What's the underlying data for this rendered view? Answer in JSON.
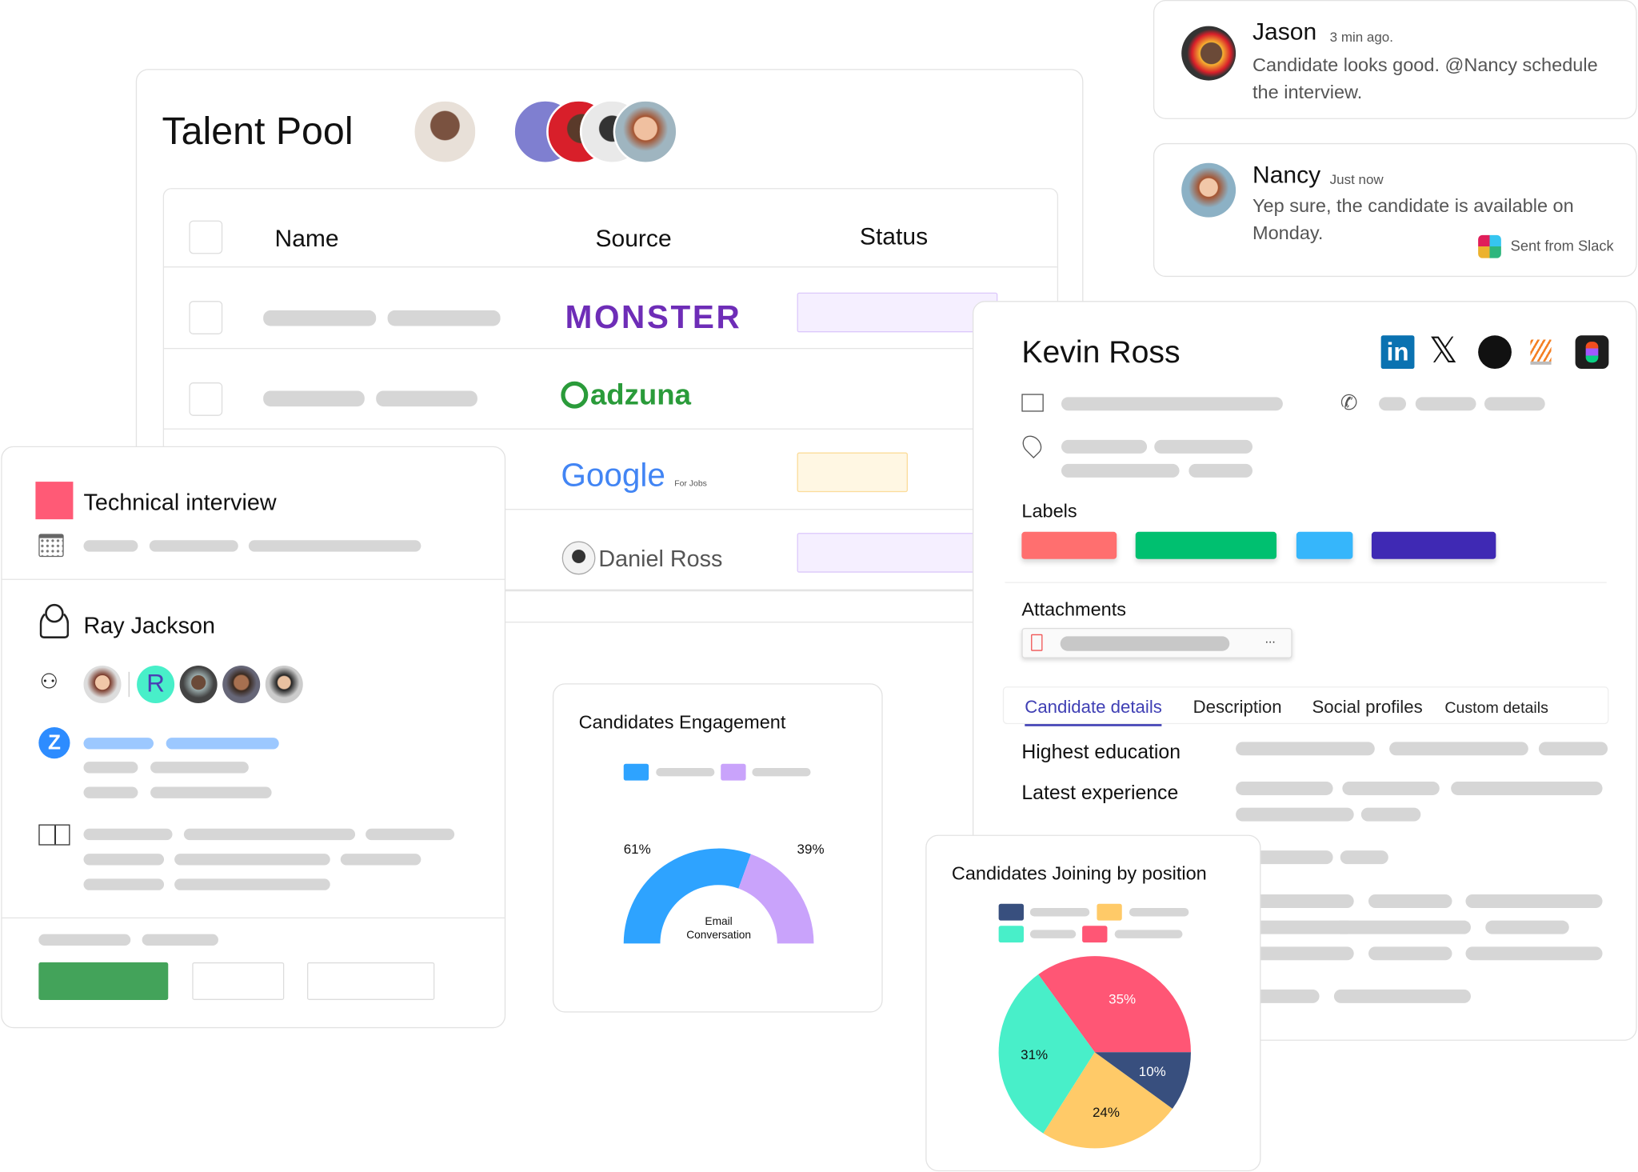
{
  "talent_pool": {
    "title": "Talent Pool",
    "columns": [
      "Name",
      "Source",
      "Status"
    ],
    "sources": [
      "MONSTER",
      "adzuna",
      "Google",
      "For Jobs",
      "Daniel Ross"
    ],
    "status_colors": [
      "#f5efff",
      "#fff7e3",
      "#f5efff"
    ]
  },
  "chat": [
    {
      "name": "Jason",
      "time": "3 min ago.",
      "message": "Candidate looks good. @Nancy schedule the interview."
    },
    {
      "name": "Nancy",
      "time": "Just now",
      "message": "Yep sure, the candidate is available on Monday.",
      "footer": "Sent from Slack"
    }
  ],
  "profile": {
    "name": "Kevin Ross",
    "social_icons": [
      "linkedin-icon",
      "x-icon",
      "github-icon",
      "stackoverflow-icon",
      "figma-icon"
    ],
    "labels_title": "Labels",
    "label_colors": [
      "#ff6f6f",
      "#00c070",
      "#36b6fb",
      "#3f29b4"
    ],
    "attachments_title": "Attachments",
    "attachment_menu": "...",
    "tabs": [
      "Candidate details",
      "Description",
      "Social profiles",
      "Custom details"
    ],
    "active_tab": 0,
    "fields": [
      "Highest education",
      "Latest experience"
    ]
  },
  "interview": {
    "title": "Technical interview",
    "accent": "#ff5a76",
    "candidate": "Ray Jackson",
    "avatar_letter": "R",
    "primary_color": "#43a35a"
  },
  "chart_data": [
    {
      "type": "pie",
      "title": "Candidates Engagement",
      "variant": "semi-donut",
      "center_label": "Email Conversation",
      "values": [
        61,
        39
      ],
      "labels": [
        "61%",
        "39%"
      ],
      "colors": [
        "#2ea3ff",
        "#c9a3fb"
      ]
    },
    {
      "type": "pie",
      "title": "Candidates Joining by position",
      "values": [
        35,
        31,
        24,
        10
      ],
      "labels": [
        "35%",
        "31%",
        "24%",
        "10%"
      ],
      "colors": [
        "#ff5675",
        "#48efc9",
        "#ffca68",
        "#384f7e"
      ]
    }
  ]
}
